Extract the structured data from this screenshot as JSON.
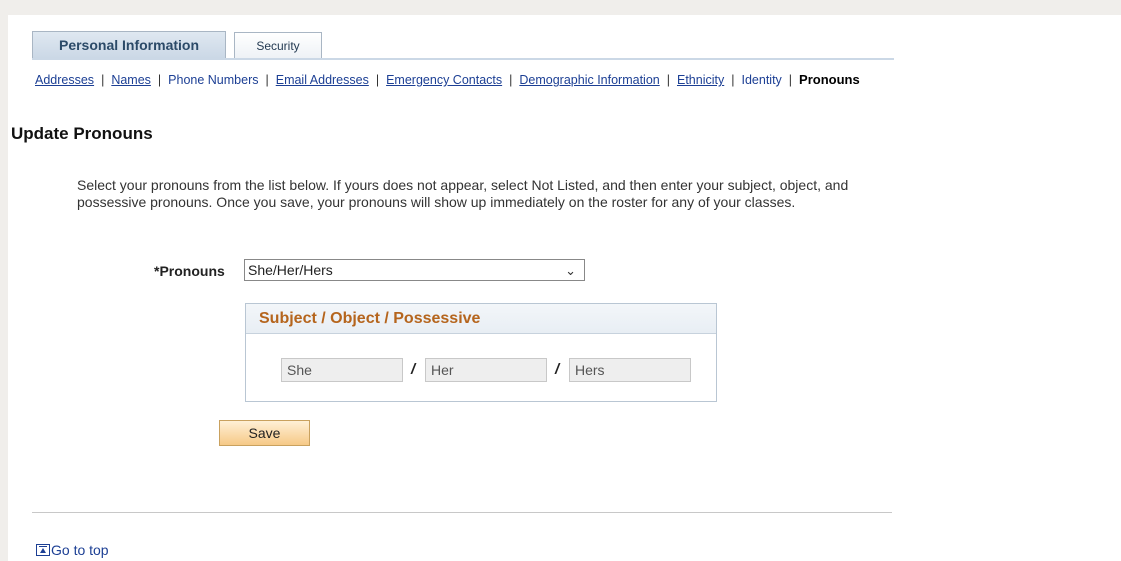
{
  "tabs": [
    {
      "label": "Personal Information",
      "active": true
    },
    {
      "label": "Security",
      "active": false
    }
  ],
  "subnav": [
    {
      "label": "Addresses"
    },
    {
      "label": "Names"
    },
    {
      "label": "Phone Numbers"
    },
    {
      "label": "Email Addresses"
    },
    {
      "label": "Emergency Contacts"
    },
    {
      "label": "Demographic Information"
    },
    {
      "label": "Ethnicity"
    },
    {
      "label": "Identity"
    },
    {
      "label": "Pronouns",
      "current": true
    }
  ],
  "separator": "|",
  "heading": "Update Pronouns",
  "instructions": "Select your pronouns from the list below. If yours does not appear, select Not Listed, and then enter your subject, object, and possessive pronouns. Once you save, your pronouns will show up immediately on the roster for any of your classes.",
  "pronouns": {
    "label": "*Pronouns",
    "selected": "She/Her/Hers",
    "chevron": "⌄"
  },
  "groupbox": {
    "title": "Subject / Object / Possessive",
    "subject": "She",
    "object": "Her",
    "possessive": "Hers",
    "slash": "/"
  },
  "save_label": "Save",
  "goto_top": "Go to top",
  "colors": {
    "link": "#1c3f94",
    "groupbox_title": "#b5651d",
    "save_bg": "#f6c987"
  }
}
